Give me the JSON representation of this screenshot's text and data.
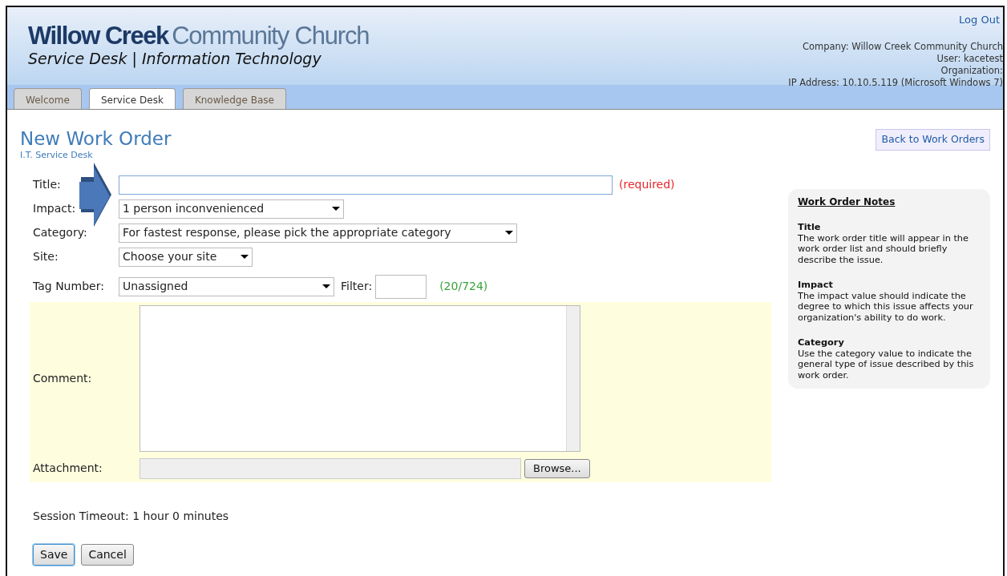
{
  "header": {
    "logo": {
      "name_primary": "Willow Creek",
      "name_secondary": "Community Church",
      "tagline": "Service Desk | Information Technology"
    },
    "log_out": "Log Out",
    "info_lines": [
      "Company: Willow Creek Community Church",
      "User: kacetest",
      "Organization:",
      "IP Address: 10.10.5.119 (Microsoft Windows 7)"
    ]
  },
  "tabs": [
    {
      "label": "Welcome",
      "selected": false
    },
    {
      "label": "Service Desk",
      "selected": true
    },
    {
      "label": "Knowledge Base",
      "selected": false
    }
  ],
  "page": {
    "title": "New Work Order",
    "subtitle": "I.T. Service Desk",
    "back_button": "Back to Work Orders"
  },
  "fields": [
    {
      "kind": "text",
      "label": "Title:",
      "required_note": "(required)"
    },
    {
      "kind": "select",
      "label": "Impact:",
      "value": "1 person inconvenienced"
    },
    {
      "kind": "select",
      "label": "Category:",
      "value": "For fastest response, please pick the appropriate category"
    },
    {
      "kind": "select",
      "label": "Site:",
      "value": "Choose your site"
    },
    {
      "kind": "tag",
      "label": "Tag Number:",
      "value": "Unassigned",
      "filter_label": "Filter:",
      "count": "(20/724)"
    }
  ],
  "comment": {
    "label": "Comment:"
  },
  "attachment": {
    "label": "Attachment:",
    "browse_button": "Browse..."
  },
  "session_timeout": "Session Timeout: 1 hour 0 minutes",
  "buttons": [
    {
      "label": "Save",
      "focused": true
    },
    {
      "label": "Cancel",
      "focused": false
    }
  ],
  "notes": {
    "title": "Work Order Notes",
    "sections": [
      {
        "heading": "Title",
        "text": "The work order title will appear in the work order list and should briefly describe the issue."
      },
      {
        "heading": "Impact",
        "text": "The impact value should indicate the degree to which this issue affects your organization's ability to do work."
      },
      {
        "heading": "Category",
        "text": "Use the category value to indicate the general type of issue described by this work order."
      }
    ]
  }
}
